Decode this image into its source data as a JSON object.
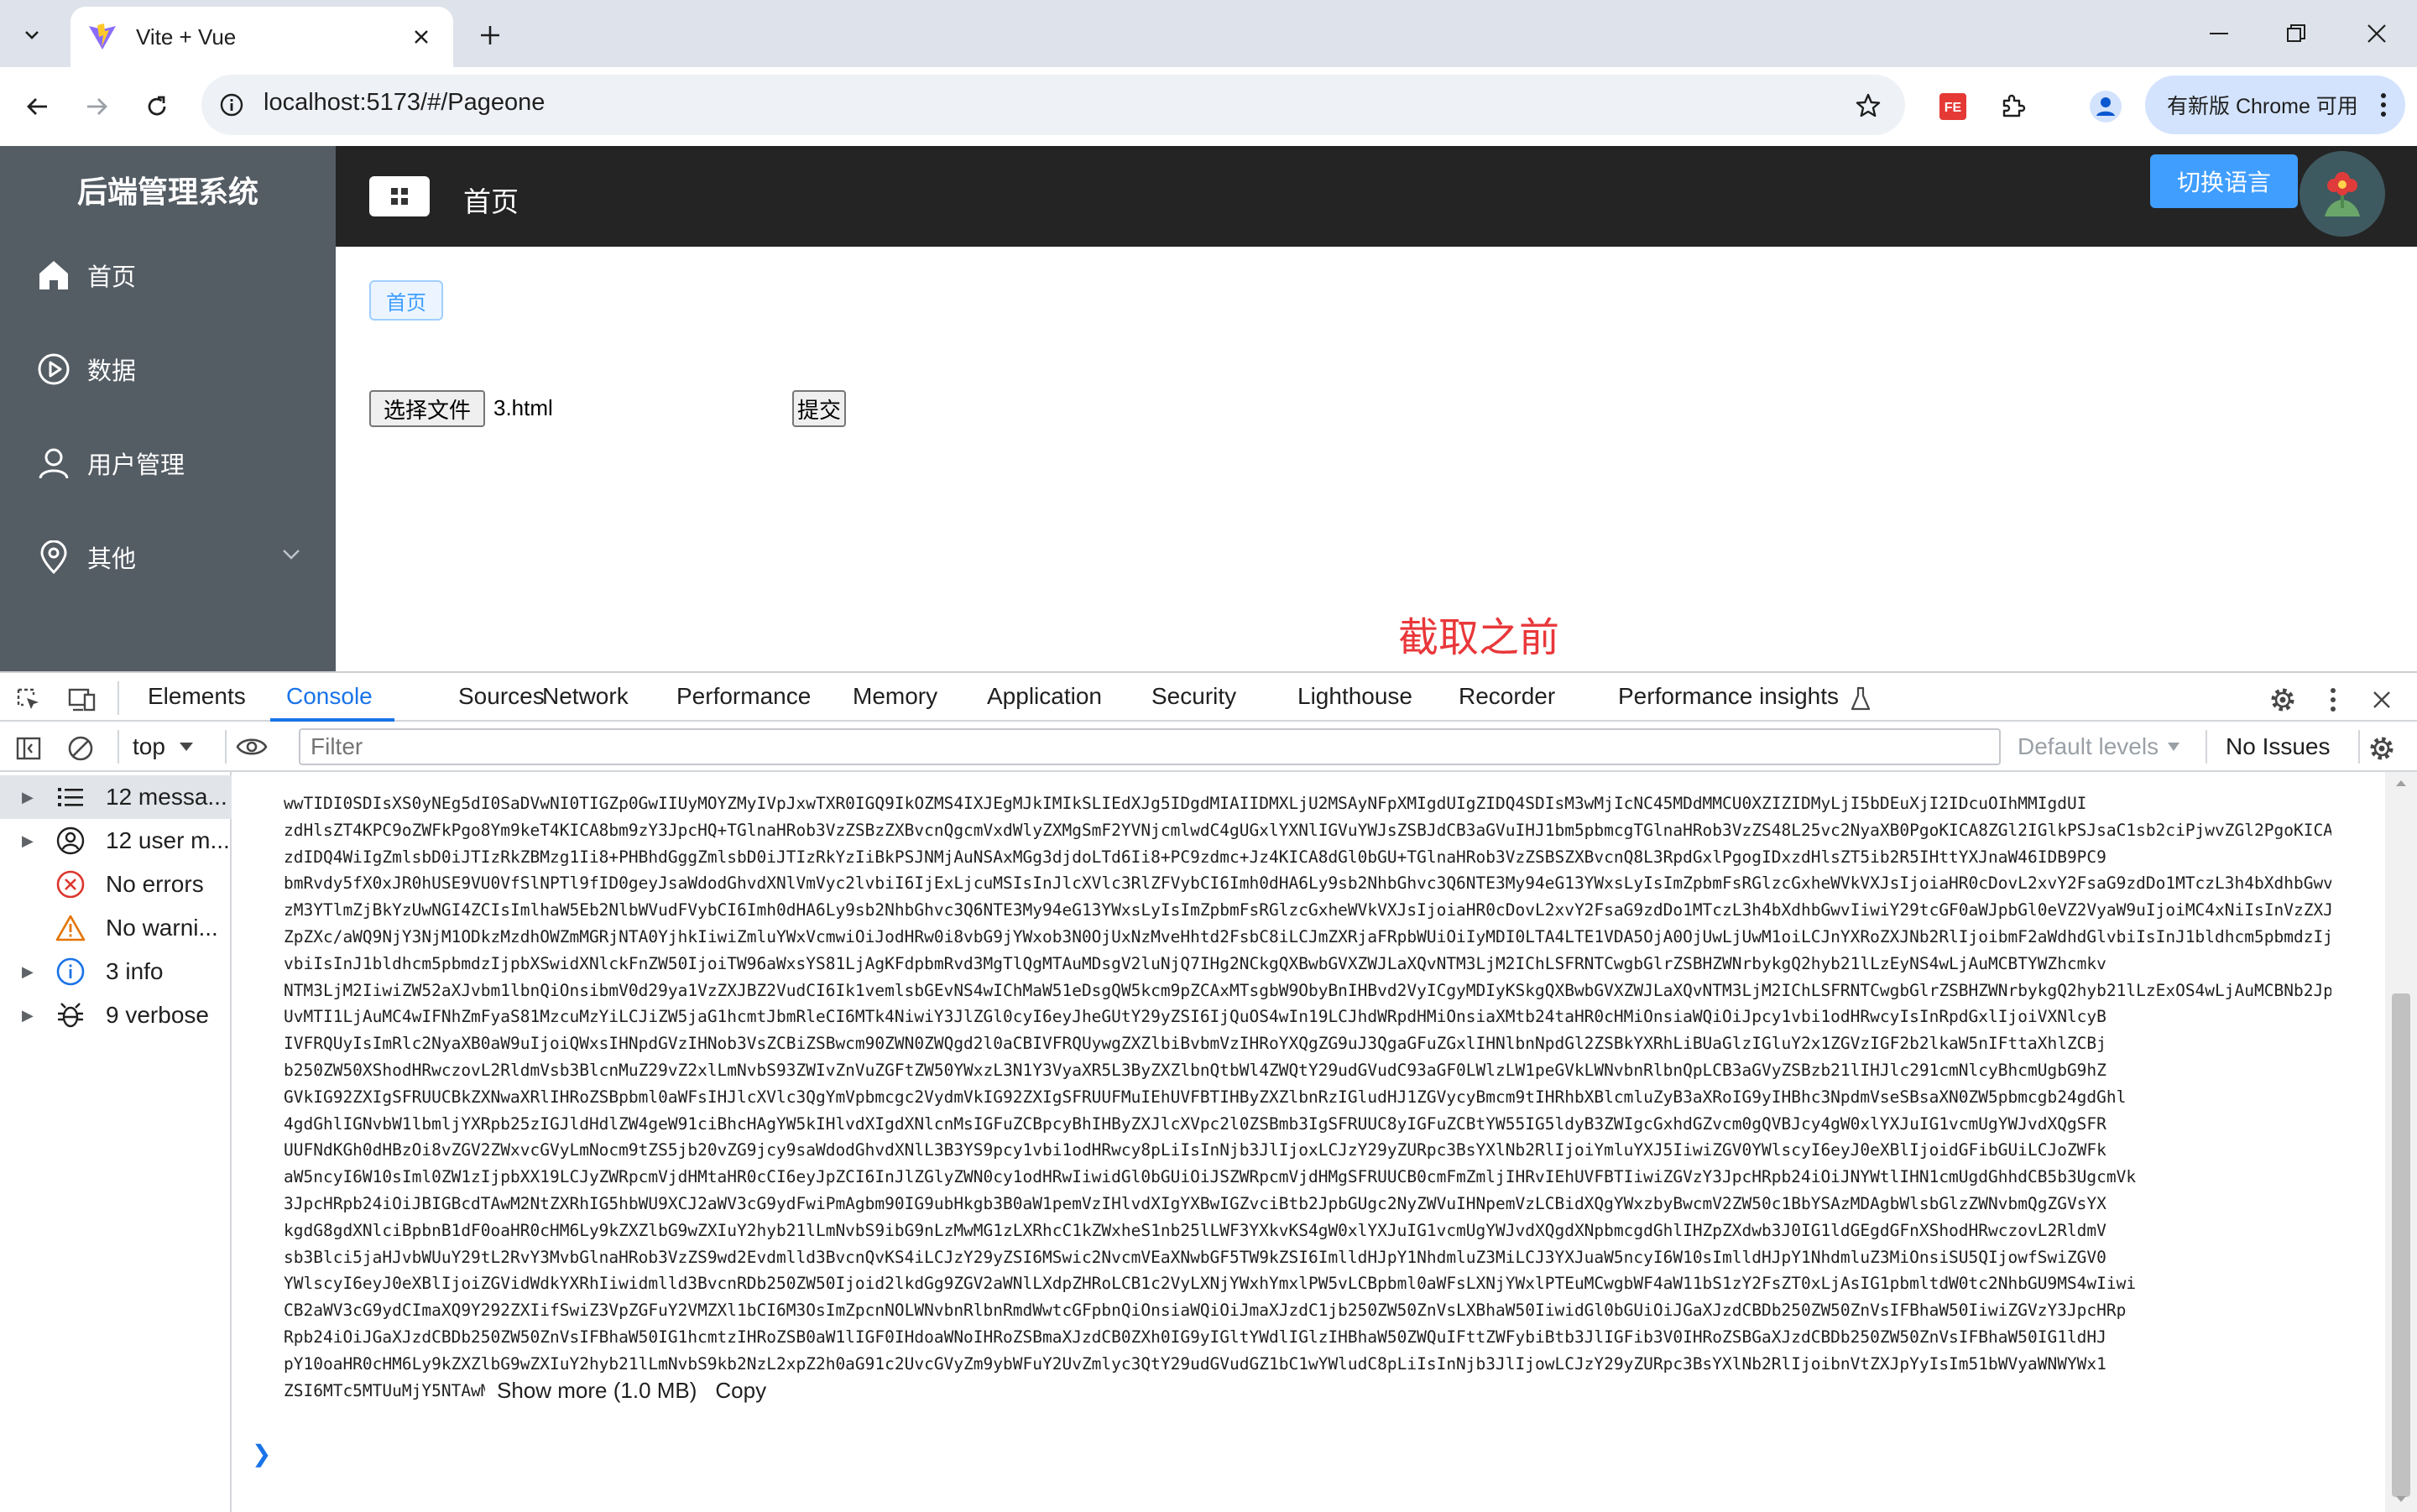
{
  "browser": {
    "tab_title": "Vite + Vue",
    "url": "localhost:5173/#/Pageone",
    "update_button": "有新版 Chrome 可用"
  },
  "app": {
    "title": "后端管理系统",
    "menu": [
      {
        "label": "首页",
        "icon": "home-icon"
      },
      {
        "label": "数据",
        "icon": "play-circle-icon"
      },
      {
        "label": "用户管理",
        "icon": "user-icon"
      },
      {
        "label": "其他",
        "icon": "location-icon"
      }
    ],
    "header_title": "首页",
    "lang_button": "切换语言",
    "breadcrumb_tag": "首页",
    "file_button": "选择文件",
    "file_name": "3.html",
    "submit_button": "提交",
    "note": "截取之前"
  },
  "devtools": {
    "tabs": [
      "Elements",
      "Console",
      "Sources",
      "Network",
      "Performance",
      "Memory",
      "Application",
      "Security",
      "Lighthouse",
      "Recorder",
      "Performance insights"
    ],
    "active_tab": "Console",
    "context": "top",
    "filter_placeholder": "Filter",
    "levels": "Default levels",
    "issues": "No Issues",
    "sidebar": [
      {
        "label": "12 messa...",
        "icon": "list-icon"
      },
      {
        "label": "12 user m...",
        "icon": "user-circle-icon"
      },
      {
        "label": "No errors",
        "icon": "error-icon"
      },
      {
        "label": "No warni...",
        "icon": "warning-icon"
      },
      {
        "label": "3 info",
        "icon": "info-icon"
      },
      {
        "label": "9 verbose",
        "icon": "bug-icon"
      }
    ],
    "log_lines": [
      "wwTIDI0SDIsXS0yNEg5dI0SaDVwNI0TIGZp0GwIIUyMOYZMyIVpJxwTXR0IGQ9IkOZMS4IXJEgMJkIMIkSLIEdXJg5IDgdMIAIIDMXLjU2MSAyNFpXMIgdUIgZIDQ4SDIsM3wMjIcNC45MDdMMCU0XZIZIDMyLjI5bDEuXjI2IDcuOIhMMIgdUI",
      "zdHlsZT4KPC9oZWFkPgo8Ym9keT4KICA8bm9zY3JpcHQ+TGlnaHRob3VzZSBzZXBvcnQgcmVxdWlyZXMgSmF2YVNjcmlwdC4gUGxlYXNlIGVuYWJsZSBJdCB3aGVuIHJ1bm5pbmcgTGlnaHRob3VzZS48L25vc2NyaXB0PgoKICA8ZGl2IGlkPSJsaC1sb2ciPjwvZGl2PgoKICA8c2NyaXB0Pndp",
      "zdIDQ4WiIgZmlsbD0iJTIzRkZBMzg1Ii8+PHBhdGggZmlsbD0iJTIzRkYzIiBkPSJNMjAuNSAxMGg3djdoLTd6Ii8+PC9zdmc+Jz4KICA8dGl0bGU+TGlnaHRob3VzZSBSZXBvcnQ8L3RpdGxlPgogIDxzdHlsZT5ib2R5IHttYXJnaW46IDB9PC9",
      "bmRvdy5fX0xJR0hUSE9VU0VfSlNPTl9fID0geyJsaWdodGhvdXNlVmVyc2lvbiI6IjExLjcuMSIsInJlcXVlc3RlZFVybCI6Imh0dHA6Ly9sb2NhbGhvc3Q6NTE3My94eG13YWxsLyIsImZpbmFsRGlzcGxheWVkVXJsIjoiaHR0cDovL2xvY2FsaG9zdDo1MTczL3h4bXdhbGwvIiwibWFpbkRvY3VtZW50VXJsIjoiaHR0cDovL2xvY2FsaG9zdDo1MTczL3h4bXdhbGwvIiwiZmV0Y2hUaW1lIjoiMjAyNC0wNy0xNlQwNzo0MToyMy41NjFaIiwiZ2F0aGVyTW9kZSI6Im5hdmlnYXRpb24iLCJydW5XYXJuaW5ncyI6W10sInVzZXJBZ2VudCI6Ik1vemlsbGEv",
      "zM3YTlmZjBkYzUwNGI4ZCIsImlhaW5Eb2NlbWVudFVybCI6Imh0dHA6Ly9sb2NhbGhvc3Q6NTE3My94eG13YWxsLyIsImZpbmFsRGlzcGxheWVkVXJsIjoiaHR0cDovL2xvY2FsaG9zdDo1MTczL3h4bXdhbGwvIiwiY29tcGF0aWJpbGl0eVZ2VyaW9uIjoiMC4xNiIsInVzZXJBZ2VudCI6Ik1vemlsbGEv",
      "ZpZXc/aWQ9NjY3NjM1ODkzMzdhOWZmMGRjNTA0YjhkIiwiZmluYWxVcmwiOiJodHRw0i8vbG9jYWxob3N0OjUxNzMveHhtd2FsbC8iLCJmZXRjaFRpbWUiOiIyMDI0LTA4LTE1VDA5OjA0OjUwLjUwM1oiLCJnYXRoZXJNb2RlIjoibmF2aWdhdGlvbiIsInJ1bldhcm5pbmdzIjpbXSwidXNlckFnZW50IjoiTW96aWxsYS81LjAgKFdpbmRvd3MgTlQgMTAuMDsgV2luNjQ7IHg2NCkgQXBwbGVXZWJLaXQvNTM3LjM2",
      "vbiIsInJ1bldhcm5pbmdzIjpbXSwidXNlckFnZW50IjoiTW96aWxsYS81LjAgKFdpbmRvd3MgTlQgMTAuMDsgV2luNjQ7IHg2NCkgQXBwbGVXZWJLaXQvNTM3LjM2IChLSFRNTCwgbGlrZSBHZWNrbykgQ2hyb21lLzEyNS4wLjAuMCBTYWZhcmkv",
      "NTM3LjM2IiwiZW52aXJvbm1lbnQiOnsibmV0d29ya1VzZXJBZ2VudCI6Ik1vemlsbGEvNS4wIChMaW51eDsgQW5kcm9pZCAxMTsgbW9ObyBnIHBvd2VyICgyMDIyKSkgQXBwbGVXZWJLaXQvNTM3LjM2IChLSFRNTCwgbGlrZSBHZWNrbykgQ2hyb21lLzExOS4wLjAuMCBNb2JpbGUgU2FmYXJpLzUzNy4zNiIsImhvc3RVc2VyQWdlbnQiOiJNb3ppbGxhLzUuMCAoV2luZG93cyBOVCAxMC4wOyBXaW42NDsgeDY0KSBBcHBsZVdlYktpdC81MzcuMzYgKEtIVE1MLCBsaWtlIEdlY2tvKSBDaHJvbW",
      "UvMTI1LjAuMC4wIFNhZmFyaS81MzcuMzYiLCJiZW5jaG1hcmtJbmRleCI6MTk4NiwiY3JlZGl0cyI6eyJheGUtY29yZSI6IjQuOS4wIn19LCJhdWRpdHMiOnsiaXMtb24taHR0cHMiOnsiaWQiOiJpcy1vbi1odHRwcyIsInRpdGxlIjoiVXNlcyB",
      "IVFRQUyIsImRlc2NyaXB0aW9uIjoiQWxsIHNpdGVzIHNob3VsZCBiZSBwcm90ZWN0ZWQgd2l0aCBIVFRQUywgZXZlbiBvbmVzIHRoYXQgZG9uJ3QgaGFuZGxlIHNlbnNpdGl2ZSBkYXRhLiBUaGlzIGluY2x1ZGVzIGF2b2lkaW5nIFttaXhlZCBj",
      "b250ZW50XShodHRwczovL2RldmVsb3BlcnMuZ29vZ2xlLmNvbS93ZWIvZnVuZGFtZW50YWxzL3N1Y3VyaXR5L3ByZXZlbnQtbWl4ZWQtY29udGVudC93aGF0LWlzLW1peGVkLWNvbnRlbnQpLCB3aGVyZSBzb21lIHJlc291cmNlcyBhcmUgbG9hZ",
      "GVkIG92ZXIgSFRUUCBkZXNwaXRlIHRoZSBpbml0aWFsIHJlcXVlc3QgYmVpbmcgc2VydmVkIG92ZXIgSFRUUFMuIEhUVFBTIHByZXZlbnRzIGludHJ1ZGVycyBmcm9tIHRhbXBlcmluZyB3aXRoIG9yIHBhc3NpdmVseSBsaXN0ZW5pbmcgb24gdGhl",
      "4gdGhlIGNvbW1lbmljYXRpb25zIGJldHdlZW4geW91ciBhcHAgYW5kIHlvdXIgdXNlcnMsIGFuZCBpcyBhIHByZXJlcXVpc2l0ZSBmb3IgSFRUUC8yIGFuZCBtYW55IG5ldyB3ZWIgcGxhdGZvcm0gQVBJcy4gW0xlYXJuIG1vcmUgYWJvdXQgSFR",
      "UUFNdKGh0dHBzOi8vZGV2ZWxvcGVyLmNocm9tZS5jb20vZG9jcy9saWdodGhvdXNlL3B3YS9pcy1vbi1odHRwcy8pLiIsInNjb3JlIjoxLCJzY29yZURpc3BsYXlNb2RlIjoiYmluYXJ5IiwiZGV0YWlscyI6eyJ0eXBlIjoidGFibGUiLCJoZWFk",
      "aW5ncyI6W10sIml0ZW1zIjpbXX19LCJyZWRpcmVjdHMtaHR0cCI6eyJpZCI6InJlZGlyZWN0cy1odHRwIiwidGl0bGUiOiJSZWRpcmVjdHMgSFRUUCB0cmFmZmljIHRvIEhUVFBTIiwiZGVzY3JpcHRpb24iOiJNYWtlIHN1cmUgdGhhdCB5b3UgcmVk",
      "3JpcHRpb24iOiJBIGBcdTAwM2NtZXRhIG5hbWU9XCJ2aWV3cG9ydFwiPmAgbm90IG9ubHkgb3B0aW1pemVzIHlvdXIgYXBwIGZvciBtb2JpbGUgc2NyZWVuIHNpemVzLCBidXQgYWxzbyBwcmV2ZW50c1BbYSAzMDAgbWlsbGlzZWNvbmQgZGVsYX",
      "kgdG8gdXNlciBpbnB1dF0oaHR0cHM6Ly9kZXZlbG9wZXIuY2hyb21lLmNvbS9ibG9nLzMwMG1zLXRhcC1kZWxheS1nb25lLWF3YXkvKS4gW0xlYXJuIG1vcmUgYWJvdXQgdXNpbmcgdGhlIHZpZXdwb3J0IG1ldGEgdGFnXShodHRwczovL2RldmV",
      "sb3Blci5jaHJvbWUuY29tL2RvY3MvbGlnaHRob3VzZS9wd2Evdmlld3BvcnQvKS4iLCJzY29yZSI6MSwic2NvcmVEaXNwbGF5TW9kZSI6ImlldHJpY1NhdmluZ3MiLCJ3YXJuaW5ncyI6W10sImlldHJpY1NhdmluZ3MiOnsiSU5QIjowfSwiZGV0",
      "YWlscyI6eyJ0eXBlIjoiZGVidWdkYXRhIiwidmlld3BvcnRDb250ZW50Ijoid2lkdGg9ZGV2aWNlLXdpZHRoLCB1c2VyLXNjYWxhYmxlPW5vLCBpbml0aWFsLXNjYWxlPTEuMCwgbWF4aW11bS1zY2FsZT0xLjAsIG1pbmltdW0tc2NhbGU9MS4wIiwi",
      "CB2aWV3cG9ydCImaXQ9Y292ZXIifSwiZ3VpZGFuY2VMZXl1bCI6M3OsImZpcnNOLWNvbnRlbnRmdWwtcGFpbnQiOnsiaWQiOiJmaXJzdC1jb250ZW50ZnVsLXBhaW50IiwidGl0bGUiOiJGaXJzdCBDb250ZW50ZnVsIFBhaW50IiwiZGVzY3JpcHRp",
      "Rpb24iOiJGaXJzdCBDb250ZW50ZnVsIFBhaW50IG1hcmtzIHRoZSB0aW1lIGF0IHdoaWNoIHRoZSBmaXJzdCB0ZXh0IG9yIGltYWdlIGlzIHBhaW50ZWQuIFttZWFybiBtb3JlIGFib3V0IHRoZSBGaXJzdCBDb250ZW50ZnVsIFBhaW50IG1ldHJ",
      "pY10oaHR0cHM6Ly9kZXZlbG9wZXIuY2hyb21lLmNvbS9kb2NzL2xpZ2h0aG91c2UvcGVyZm9ybWFuY2UvZmlyc3QtY29udGVudGZ1bC1wYWludC8pLiIsInNjb3JlIjowLCJzY29yZURpc3BsYXlNb2RlIjoibnVtZXJpYyIsIm51bWVyaWNWYWx1",
      "ZSI6MTc5MTUuMjY5NTAwMDAwMDI0LCJudW1lcmljVW5pdCI6Im1pbGxpc2Vjb25kIiwiZGlzcGxheVZhbHVlIjoiMTcuOCKgcyIsInNjb3JpbmdPcHRpb25zIjp7InAxMCI6MTgwMCwibWVkaWFuIjozMDAwfX0sImxhcmdlc3QtY29udGVudGZ1bC1wYWludCI6eyJpZCI6Im"
    ],
    "show_more": "Show more (1.0 MB)",
    "copy": "Copy"
  }
}
